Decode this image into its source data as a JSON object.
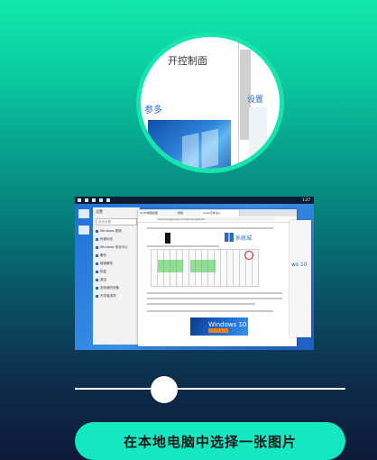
{
  "magnifier": {
    "zoom_text_top": "开控制面",
    "zoom_text_left": "参多",
    "zoom_text_right": "设置"
  },
  "screenshot": {
    "taskbar_time": "1:27",
    "settings_panel": {
      "title": "设置",
      "search_placeholder": "查找设置",
      "items": [
        "Windows 更新",
        "传递优化",
        "Windows 安全中心",
        "备份",
        "疑难解答",
        "恢复",
        "激活",
        "查找我的设备",
        "开发者选项"
      ]
    },
    "browser": {
      "tabs": [
        "win10电脑截图",
        "教程",
        "win10怎样进入..."
      ],
      "address": "www.xitongcheng.com/jiaocheng/win10",
      "logo_text": "系统城",
      "banner_text": "Windows 10"
    },
    "side_window_text": "ws 10"
  },
  "slider": {
    "value": 0.28
  },
  "button": {
    "label": "在本地电脑中选择一张图片"
  },
  "colors": {
    "accent": "#13e8c0",
    "background_top": "#12e8ac",
    "background_bottom": "#0e1a3a"
  }
}
